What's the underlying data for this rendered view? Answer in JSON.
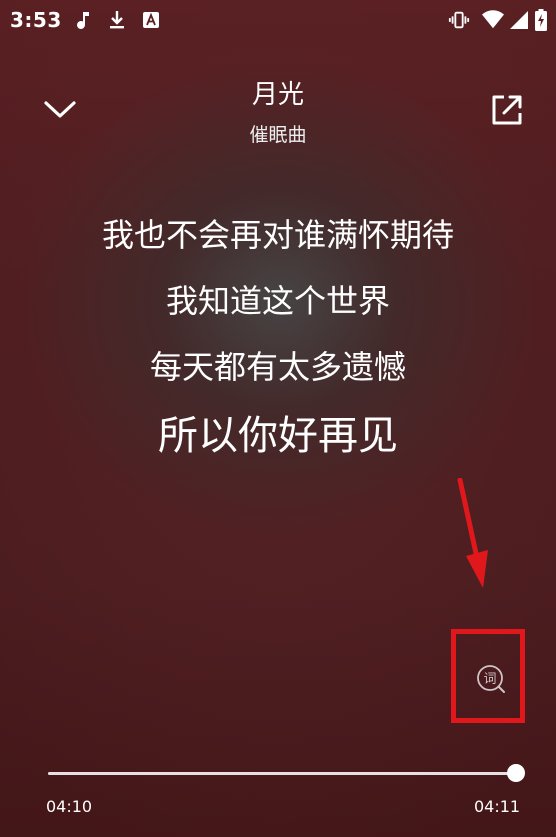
{
  "status_bar": {
    "time": "3:53",
    "icons": [
      "music-note-icon",
      "download-icon",
      "app-a-icon",
      "vibrate-icon",
      "wifi-icon",
      "signal-icon",
      "battery-charging-icon"
    ]
  },
  "header": {
    "title": "月光",
    "artist": "催眠曲",
    "collapse_icon": "chevron-down-icon",
    "share_icon": "share-external-icon"
  },
  "lyrics": {
    "lines": [
      "我也不会再对谁满怀期待",
      "我知道这个世界",
      "每天都有太多遗憾",
      "所以你好再见"
    ],
    "current_index": 3
  },
  "lyric_button": {
    "glyph": "词",
    "icon": "lyrics-search-icon"
  },
  "annotation": {
    "color": "#e0181c"
  },
  "player": {
    "current_time": "04:10",
    "total_time": "04:11",
    "progress_percent": 99.6
  }
}
